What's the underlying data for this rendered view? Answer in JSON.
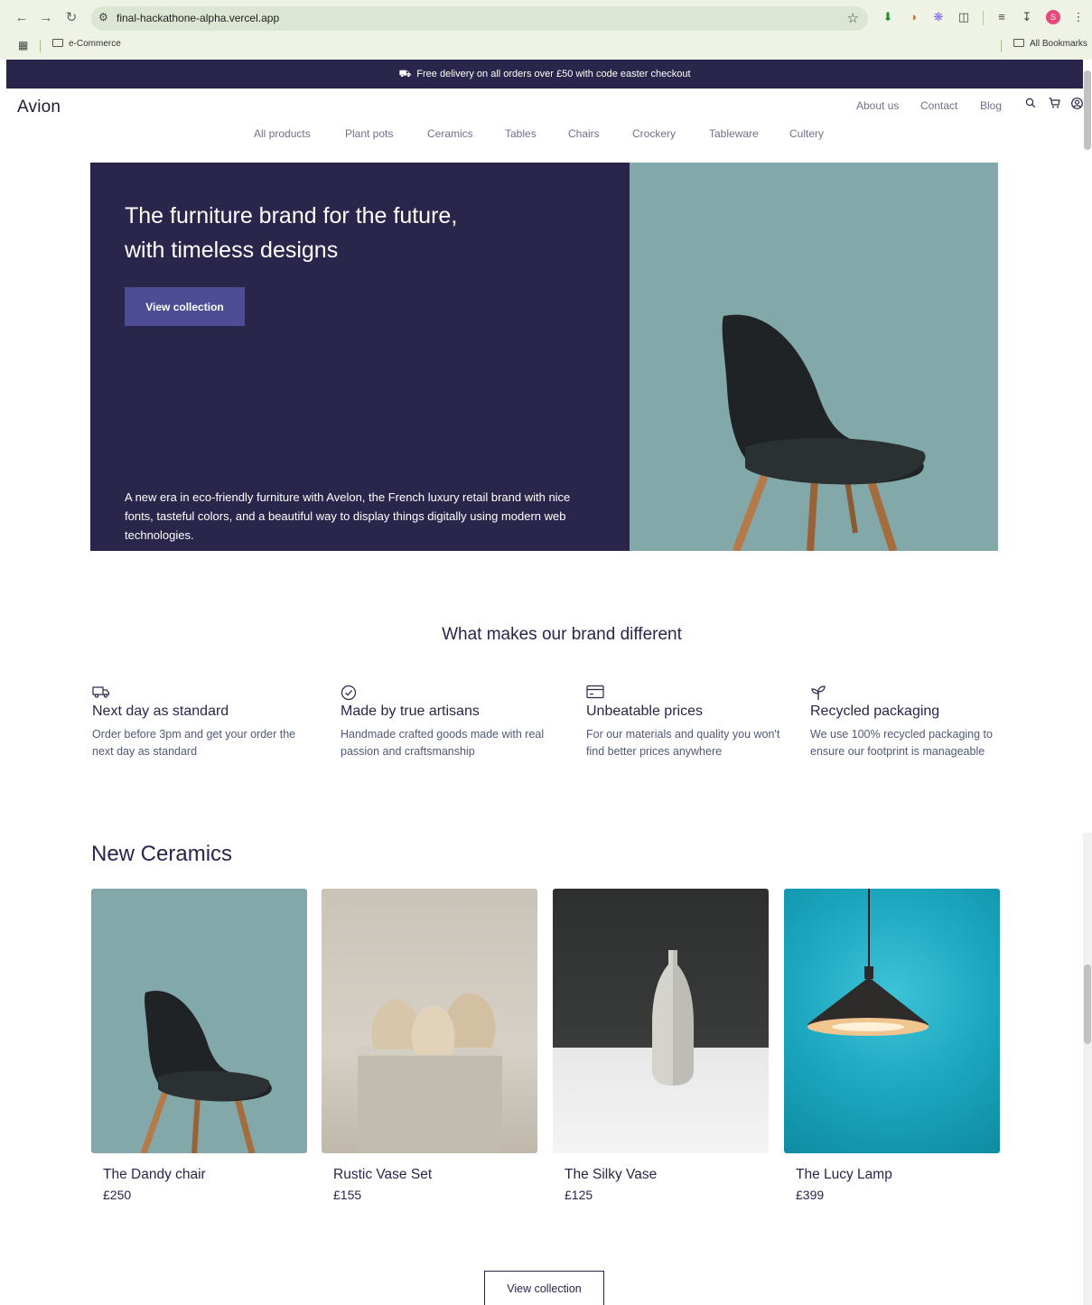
{
  "browser": {
    "url": "final-hackathone-alpha.vercel.app",
    "avatar_letter": "S",
    "bookmarks": [
      "e-Commerce"
    ],
    "all_bookmarks": "All Bookmarks"
  },
  "promo": {
    "text": "Free delivery on all orders over £50 with code easter checkout"
  },
  "header": {
    "logo": "Avion",
    "top_links": [
      "About us",
      "Contact",
      "Blog"
    ],
    "categories": [
      "All products",
      "Plant pots",
      "Ceramics",
      "Tables",
      "Chairs",
      "Crockery",
      "Tableware",
      "Cultery"
    ]
  },
  "hero": {
    "title": "The furniture brand for the future, with timeless designs",
    "button": "View collection",
    "description": "A new era in eco-friendly furniture with Avelon, the French luxury retail brand with nice fonts, tasteful colors, and a beautiful way to display things digitally using modern web technologies.",
    "colors": {
      "left": "#2a254b",
      "right": "#83a8a9",
      "button": "#4e4d93"
    }
  },
  "brand": {
    "title": "What makes our brand different",
    "features": [
      {
        "icon": "delivery-truck-icon",
        "title": "Next day as standard",
        "text": "Order before 3pm and get your order the next day as standard"
      },
      {
        "icon": "check-circle-icon",
        "title": "Made by true artisans",
        "text": "Handmade crafted goods made with real passion and craftsmanship"
      },
      {
        "icon": "credit-card-icon",
        "title": "Unbeatable prices",
        "text": "For our materials and quality you won't find better prices anywhere"
      },
      {
        "icon": "sprout-icon",
        "title": "Recycled packaging",
        "text": "We use 100% recycled packaging to ensure our footprint is manageable"
      }
    ]
  },
  "products": {
    "heading": "New Ceramics",
    "items": [
      {
        "name": "The Dandy chair",
        "price": "£250"
      },
      {
        "name": "Rustic Vase Set",
        "price": "£155"
      },
      {
        "name": "The Silky Vase",
        "price": "£125"
      },
      {
        "name": "The Lucy Lamp",
        "price": "£399"
      }
    ],
    "button": "View collection"
  }
}
